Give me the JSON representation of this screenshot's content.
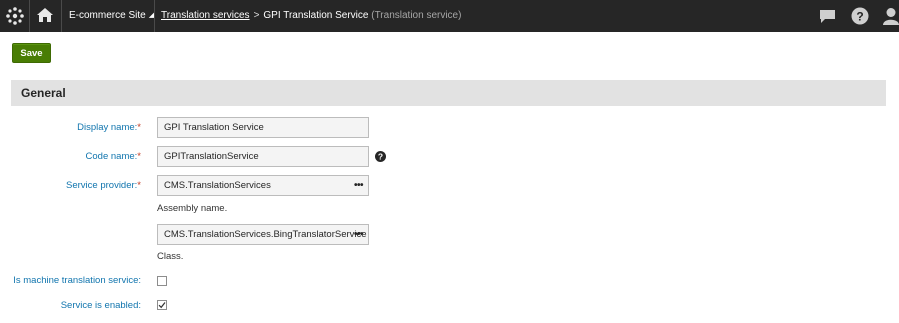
{
  "topbar": {
    "site_name": "E-commerce Site",
    "breadcrumb": {
      "link": "Translation services",
      "current": "GPI Translation Service",
      "suffix": "(Translation service)"
    },
    "colors": {
      "background": "#262626",
      "text": "#ffffff"
    },
    "icons": [
      "kentico-logo-icon",
      "home-icon",
      "chat-icon",
      "help-icon",
      "user-icon"
    ]
  },
  "toolbar": {
    "save_label": "Save",
    "save_color": "#497d04"
  },
  "section": {
    "title": "General"
  },
  "form": {
    "display_name": {
      "label": "Display name:",
      "required": "*",
      "value": "GPI Translation Service"
    },
    "code_name": {
      "label": "Code name:",
      "required": "*",
      "value": "GPITranslationService"
    },
    "service_provider": {
      "label": "Service provider:",
      "required": "*",
      "assembly_value": "CMS.TranslationServices",
      "assembly_explanation": "Assembly name.",
      "class_value": "CMS.TranslationServices.BingTranslatorService",
      "class_explanation": "Class.",
      "browse_label": "•••"
    },
    "machine_translation": {
      "label": "Is machine translation service:",
      "checked": false
    },
    "service_enabled": {
      "label": "Service is enabled:",
      "checked": true
    }
  }
}
